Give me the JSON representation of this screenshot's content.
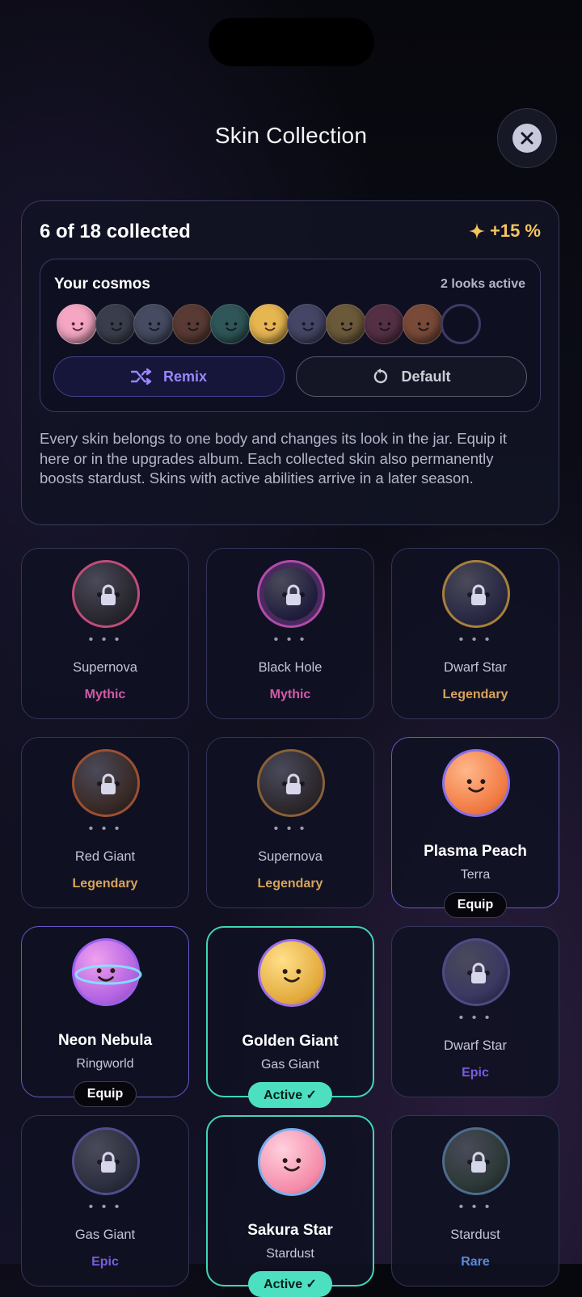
{
  "header": {
    "title": "Skin Collection",
    "close_icon": "close-icon"
  },
  "summary": {
    "collected": "6 of 18 collected",
    "bonus": "+15 %",
    "bonus_icon": "sparkle-icon",
    "cosmos_title": "Your cosmos",
    "looks_active": "2 looks active",
    "orb_colors": [
      "#f4a6c2",
      "#3a3d4c",
      "#464b61",
      "#5a3a34",
      "#2f5658",
      "#e6b650",
      "#454566",
      "#6b5a3a",
      "#553045",
      "#7a4a38"
    ],
    "remix_label": "Remix",
    "default_label": "Default",
    "description": "Every skin belongs to one body and changes its look in the jar. Equip it here or in the upgrades album. Each collected skin also permanently boosts stardust. Skins with active abilities arrive in a later season."
  },
  "rarity_colors": {
    "Mythic": "#d35aa8",
    "Legendary": "#d9a35a",
    "Epic": "#7a5ce0",
    "Rare": "#5a8ad9"
  },
  "skins": [
    {
      "name": "Supernova",
      "rarity": "Mythic",
      "locked": true,
      "dots": "• • •"
    },
    {
      "name": "Black Hole",
      "rarity": "Mythic",
      "locked": true,
      "dots": "• • •"
    },
    {
      "name": "Dwarf Star",
      "rarity": "Legendary",
      "locked": true,
      "dots": "• • •"
    },
    {
      "name": "Red Giant",
      "rarity": "Legendary",
      "locked": true,
      "dots": "• • •"
    },
    {
      "name": "Supernova",
      "rarity": "Legendary",
      "locked": true,
      "dots": "• • •"
    },
    {
      "name": "Plasma Peach",
      "body": "Terra",
      "action": "Equip",
      "locked": false
    },
    {
      "name": "Neon Nebula",
      "body": "Ringworld",
      "action": "Equip",
      "locked": false
    },
    {
      "name": "Golden Giant",
      "body": "Gas Giant",
      "action": "Active ✓",
      "locked": false
    },
    {
      "name": "Dwarf Star",
      "rarity": "Epic",
      "locked": true,
      "dots": "• • •"
    },
    {
      "name": "Gas Giant",
      "rarity": "Epic",
      "locked": true,
      "dots": "• • •"
    },
    {
      "name": "Sakura Star",
      "body": "Stardust",
      "action": "Active ✓",
      "locked": false
    },
    {
      "name": "Stardust",
      "rarity": "Rare",
      "locked": true,
      "dots": "• • •"
    }
  ]
}
